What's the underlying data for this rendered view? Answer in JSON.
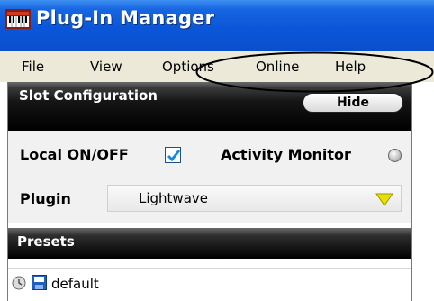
{
  "window": {
    "title": "Plug-In Manager",
    "app_icon": "keyboard-icon"
  },
  "menubar": {
    "items": [
      "File",
      "View",
      "Options",
      "Online",
      "Help"
    ]
  },
  "slot_configuration": {
    "title": "Slot Configuration",
    "hide_button": "Hide",
    "local_label": "Local ON/OFF",
    "local_checked": true,
    "activity_monitor_label": "Activity Monitor",
    "plugin_label": "Plugin",
    "plugin_value": "Lightwave"
  },
  "presets": {
    "title": "Presets",
    "items": [
      {
        "label": "default"
      }
    ]
  },
  "colors": {
    "titlebar": "#0b56d8",
    "menubar": "#ece9d8",
    "header_black": "#000000",
    "dropdown_arrow": "#e8e000",
    "checkbox_check": "#1a8be0"
  }
}
